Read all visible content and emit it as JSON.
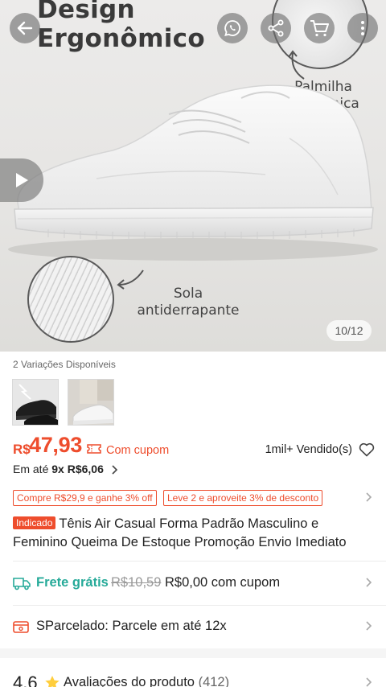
{
  "hero": {
    "title_line1": "Design",
    "title_line2": "Ergonômico",
    "callout_top_line1": "Palmilha",
    "callout_top_line2": "anatômica",
    "callout_bottom_line1": "Sola",
    "callout_bottom_line2": "antiderrapante",
    "image_counter": "10/12"
  },
  "header_icons": [
    "back-arrow-icon",
    "whatsapp-icon",
    "share-icon",
    "cart-icon",
    "more-vertical-icon"
  ],
  "variations": {
    "label": "2 Variações Disponíveis",
    "thumbnails": [
      "black-sneaker",
      "white-sneaker"
    ]
  },
  "price": {
    "currency": "R$",
    "value": "47,93",
    "coupon_label": "Com cupom",
    "sold": "1mil+ Vendido(s)",
    "installments_prefix": "Em até ",
    "installments_value": "9x R$6,06"
  },
  "promos": {
    "tag1": "Compre R$29,9 e ganhe 3% off",
    "tag2": "Leve 2 e aproveite 3% de desconto"
  },
  "product": {
    "badge": "Indicado",
    "title": "Tênis Air Casual Forma Padrão Masculino e Feminino Queima De Estoque Promoção Envio Imediato"
  },
  "shipping": {
    "label": "Frete grátis",
    "old_price": "R$10,59",
    "new_price": "R$0,00 com cupom"
  },
  "parcelado": {
    "label": "SParcelado: Parcele em até 12x"
  },
  "rating": {
    "score": "4.6",
    "label": "Avaliações do produto",
    "count": "(412)"
  },
  "colors": {
    "accent": "#ee4d2d",
    "shipping_green": "#26aa99"
  }
}
